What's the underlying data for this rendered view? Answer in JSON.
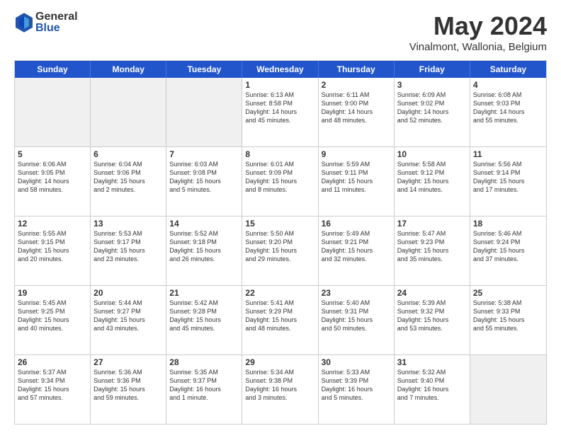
{
  "header": {
    "logo_general": "General",
    "logo_blue": "Blue",
    "title": "May 2024",
    "location": "Vinalmont, Wallonia, Belgium"
  },
  "days_of_week": [
    "Sunday",
    "Monday",
    "Tuesday",
    "Wednesday",
    "Thursday",
    "Friday",
    "Saturday"
  ],
  "weeks": [
    [
      {
        "day": "",
        "info": "",
        "shaded": true
      },
      {
        "day": "",
        "info": "",
        "shaded": true
      },
      {
        "day": "",
        "info": "",
        "shaded": true
      },
      {
        "day": "1",
        "info": "Sunrise: 6:13 AM\nSunset: 8:58 PM\nDaylight: 14 hours\nand 45 minutes.",
        "shaded": false
      },
      {
        "day": "2",
        "info": "Sunrise: 6:11 AM\nSunset: 9:00 PM\nDaylight: 14 hours\nand 48 minutes.",
        "shaded": false
      },
      {
        "day": "3",
        "info": "Sunrise: 6:09 AM\nSunset: 9:02 PM\nDaylight: 14 hours\nand 52 minutes.",
        "shaded": false
      },
      {
        "day": "4",
        "info": "Sunrise: 6:08 AM\nSunset: 9:03 PM\nDaylight: 14 hours\nand 55 minutes.",
        "shaded": false
      }
    ],
    [
      {
        "day": "5",
        "info": "Sunrise: 6:06 AM\nSunset: 9:05 PM\nDaylight: 14 hours\nand 58 minutes.",
        "shaded": false
      },
      {
        "day": "6",
        "info": "Sunrise: 6:04 AM\nSunset: 9:06 PM\nDaylight: 15 hours\nand 2 minutes.",
        "shaded": false
      },
      {
        "day": "7",
        "info": "Sunrise: 6:03 AM\nSunset: 9:08 PM\nDaylight: 15 hours\nand 5 minutes.",
        "shaded": false
      },
      {
        "day": "8",
        "info": "Sunrise: 6:01 AM\nSunset: 9:09 PM\nDaylight: 15 hours\nand 8 minutes.",
        "shaded": false
      },
      {
        "day": "9",
        "info": "Sunrise: 5:59 AM\nSunset: 9:11 PM\nDaylight: 15 hours\nand 11 minutes.",
        "shaded": false
      },
      {
        "day": "10",
        "info": "Sunrise: 5:58 AM\nSunset: 9:12 PM\nDaylight: 15 hours\nand 14 minutes.",
        "shaded": false
      },
      {
        "day": "11",
        "info": "Sunrise: 5:56 AM\nSunset: 9:14 PM\nDaylight: 15 hours\nand 17 minutes.",
        "shaded": false
      }
    ],
    [
      {
        "day": "12",
        "info": "Sunrise: 5:55 AM\nSunset: 9:15 PM\nDaylight: 15 hours\nand 20 minutes.",
        "shaded": false
      },
      {
        "day": "13",
        "info": "Sunrise: 5:53 AM\nSunset: 9:17 PM\nDaylight: 15 hours\nand 23 minutes.",
        "shaded": false
      },
      {
        "day": "14",
        "info": "Sunrise: 5:52 AM\nSunset: 9:18 PM\nDaylight: 15 hours\nand 26 minutes.",
        "shaded": false
      },
      {
        "day": "15",
        "info": "Sunrise: 5:50 AM\nSunset: 9:20 PM\nDaylight: 15 hours\nand 29 minutes.",
        "shaded": false
      },
      {
        "day": "16",
        "info": "Sunrise: 5:49 AM\nSunset: 9:21 PM\nDaylight: 15 hours\nand 32 minutes.",
        "shaded": false
      },
      {
        "day": "17",
        "info": "Sunrise: 5:47 AM\nSunset: 9:23 PM\nDaylight: 15 hours\nand 35 minutes.",
        "shaded": false
      },
      {
        "day": "18",
        "info": "Sunrise: 5:46 AM\nSunset: 9:24 PM\nDaylight: 15 hours\nand 37 minutes.",
        "shaded": false
      }
    ],
    [
      {
        "day": "19",
        "info": "Sunrise: 5:45 AM\nSunset: 9:25 PM\nDaylight: 15 hours\nand 40 minutes.",
        "shaded": false
      },
      {
        "day": "20",
        "info": "Sunrise: 5:44 AM\nSunset: 9:27 PM\nDaylight: 15 hours\nand 43 minutes.",
        "shaded": false
      },
      {
        "day": "21",
        "info": "Sunrise: 5:42 AM\nSunset: 9:28 PM\nDaylight: 15 hours\nand 45 minutes.",
        "shaded": false
      },
      {
        "day": "22",
        "info": "Sunrise: 5:41 AM\nSunset: 9:29 PM\nDaylight: 15 hours\nand 48 minutes.",
        "shaded": false
      },
      {
        "day": "23",
        "info": "Sunrise: 5:40 AM\nSunset: 9:31 PM\nDaylight: 15 hours\nand 50 minutes.",
        "shaded": false
      },
      {
        "day": "24",
        "info": "Sunrise: 5:39 AM\nSunset: 9:32 PM\nDaylight: 15 hours\nand 53 minutes.",
        "shaded": false
      },
      {
        "day": "25",
        "info": "Sunrise: 5:38 AM\nSunset: 9:33 PM\nDaylight: 15 hours\nand 55 minutes.",
        "shaded": false
      }
    ],
    [
      {
        "day": "26",
        "info": "Sunrise: 5:37 AM\nSunset: 9:34 PM\nDaylight: 15 hours\nand 57 minutes.",
        "shaded": false
      },
      {
        "day": "27",
        "info": "Sunrise: 5:36 AM\nSunset: 9:36 PM\nDaylight: 15 hours\nand 59 minutes.",
        "shaded": false
      },
      {
        "day": "28",
        "info": "Sunrise: 5:35 AM\nSunset: 9:37 PM\nDaylight: 16 hours\nand 1 minute.",
        "shaded": false
      },
      {
        "day": "29",
        "info": "Sunrise: 5:34 AM\nSunset: 9:38 PM\nDaylight: 16 hours\nand 3 minutes.",
        "shaded": false
      },
      {
        "day": "30",
        "info": "Sunrise: 5:33 AM\nSunset: 9:39 PM\nDaylight: 16 hours\nand 5 minutes.",
        "shaded": false
      },
      {
        "day": "31",
        "info": "Sunrise: 5:32 AM\nSunset: 9:40 PM\nDaylight: 16 hours\nand 7 minutes.",
        "shaded": false
      },
      {
        "day": "",
        "info": "",
        "shaded": true
      }
    ]
  ]
}
